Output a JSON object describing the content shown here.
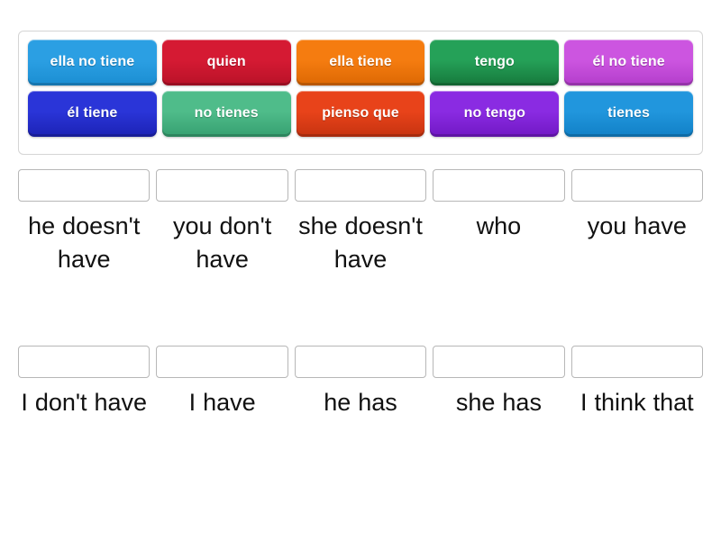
{
  "activity": {
    "type": "match-up",
    "tile_bank": {
      "rows": [
        [
          {
            "label": "ella no tiene",
            "color": "#2b9fe3",
            "color_dark": "#1b8ed2"
          },
          {
            "label": "quien",
            "color": "#d51a33",
            "color_dark": "#b81228"
          },
          {
            "label": "ella tiene",
            "color": "#f57c10",
            "color_dark": "#dc6803"
          },
          {
            "label": "tengo",
            "color": "#25a158",
            "color_dark": "#16783c"
          },
          {
            "label": "él no tiene",
            "color": "#cc55e0",
            "color_dark": "#b33dcb"
          }
        ],
        [
          {
            "label": "él tiene",
            "color": "#2a35d8",
            "color_dark": "#1c22b4"
          },
          {
            "label": "no tienes",
            "color": "#4fbc8a",
            "color_dark": "#36a070"
          },
          {
            "label": "pienso que",
            "color": "#e8431a",
            "color_dark": "#c63310"
          },
          {
            "label": "no tengo",
            "color": "#8a2be2",
            "color_dark": "#7118c4"
          },
          {
            "label": "tienes",
            "color": "#2196dd",
            "color_dark": "#1180c6"
          }
        ]
      ]
    },
    "answer_rows": [
      {
        "cells": [
          {
            "answer": "he doesn't have",
            "dropped": ""
          },
          {
            "answer": "you don't have",
            "dropped": ""
          },
          {
            "answer": "she doesn't have",
            "dropped": ""
          },
          {
            "answer": "who",
            "dropped": ""
          },
          {
            "answer": "you have",
            "dropped": ""
          }
        ]
      },
      {
        "cells": [
          {
            "answer": "I don't have",
            "dropped": ""
          },
          {
            "answer": "I have",
            "dropped": ""
          },
          {
            "answer": "he has",
            "dropped": ""
          },
          {
            "answer": "she has",
            "dropped": ""
          },
          {
            "answer": "I think that",
            "dropped": ""
          }
        ]
      }
    ]
  },
  "colors": {
    "page_background": "#ffffff",
    "bank_border": "#d5d5d5",
    "drop_zone_border": "#b7b7b7",
    "answer_text": "#111111",
    "tile_text": "#ffffff"
  }
}
